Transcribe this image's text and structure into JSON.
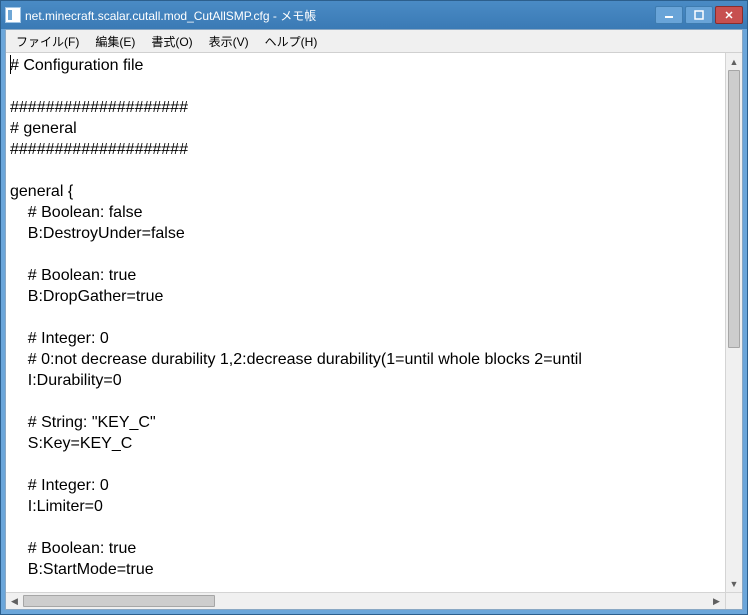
{
  "window": {
    "title": "net.minecraft.scalar.cutall.mod_CutAllSMP.cfg - メモ帳"
  },
  "menu": {
    "file": "ファイル(F)",
    "edit": "編集(E)",
    "format": "書式(O)",
    "view": "表示(V)",
    "help": "ヘルプ(H)"
  },
  "editor": {
    "content": "# Configuration file\n\n####################\n# general\n####################\n\ngeneral {\n    # Boolean: false\n    B:DestroyUnder=false\n\n    # Boolean: true\n    B:DropGather=true\n\n    # Integer: 0\n    # 0:not decrease durability 1,2:decrease durability(1=until whole blocks 2=until \n    I:Durability=0\n\n    # String: \"KEY_C\"\n    S:Key=KEY_C\n\n    # Integer: 0\n    I:Limiter=0\n\n    # Boolean: true\n    B:StartMode=true"
  }
}
